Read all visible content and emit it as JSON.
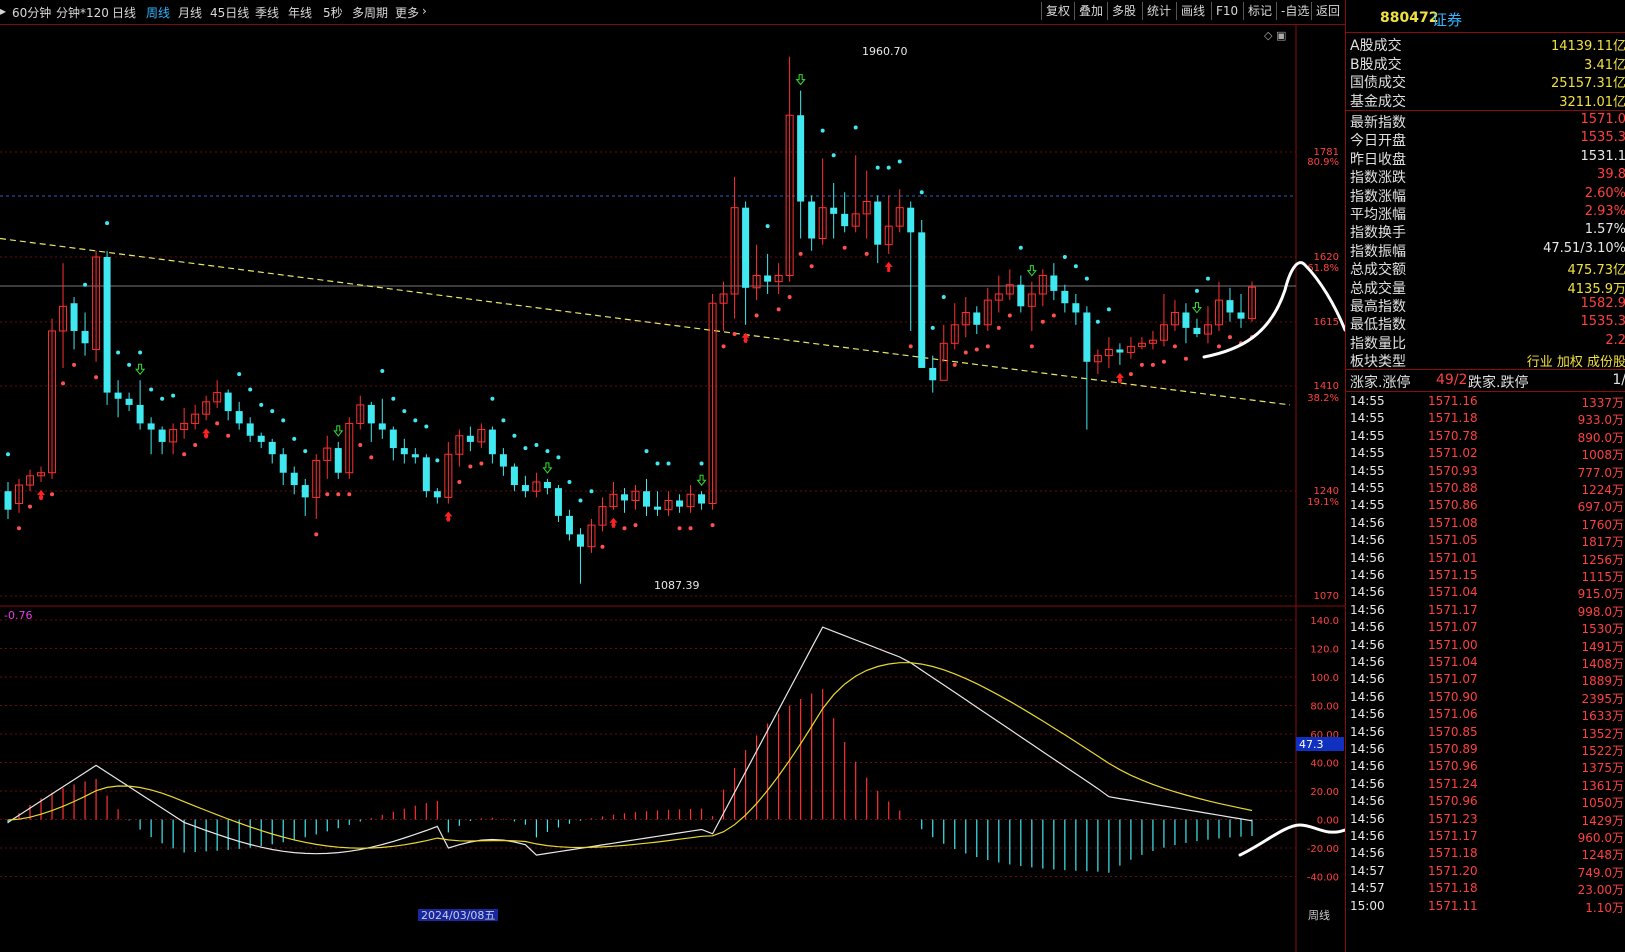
{
  "toolbar": {
    "periods": [
      "60分钟",
      "分钟*120",
      "日线",
      "周线",
      "月线",
      "45日线",
      "季线",
      "年线",
      "5秒",
      "多周期",
      "更多"
    ],
    "active_period": "周线",
    "actions": [
      "复权",
      "叠加",
      "多股",
      "统计",
      "画线",
      "F10",
      "标记",
      "-自选",
      "返回"
    ]
  },
  "chart": {
    "high_label": "1960.70",
    "low_label": "1087.39",
    "price_axis": [
      "1781",
      "1620",
      "1615",
      "1410",
      "1240",
      "1070"
    ],
    "pct_axis": [
      "80.9%",
      "61.8%",
      "38.2%",
      "19.1%"
    ],
    "macd_label": "-0.76",
    "macd_axis": [
      "140.0",
      "120.0",
      "100.0",
      "80.00",
      "60.00",
      "40.00",
      "20.00",
      "0.00",
      "-20.00",
      "-40.00"
    ],
    "macd_value_box": "47.3",
    "date_label": "2024/03/08五",
    "period_footer": "周线",
    "colors": {
      "up": "#ff3030",
      "down": "#40e8f0",
      "sar_down": "#40e8f0",
      "sar_up": "#ff5050",
      "trend": "#e8e860",
      "dif": "#e8e8e8",
      "dea": "#e8d830"
    }
  },
  "chart_data": {
    "type": "candlestick",
    "y_range": [
      1070,
      1960.7
    ],
    "candles": [
      [
        1240,
        1210,
        1255,
        1195
      ],
      [
        1220,
        1250,
        1260,
        1205
      ],
      [
        1250,
        1265,
        1275,
        1240
      ],
      [
        1265,
        1270,
        1280,
        1255
      ],
      [
        1270,
        1500,
        1520,
        1260
      ],
      [
        1500,
        1540,
        1610,
        1440
      ],
      [
        1545,
        1500,
        1555,
        1470
      ],
      [
        1500,
        1480,
        1530,
        1460
      ],
      [
        1470,
        1620,
        1630,
        1450
      ],
      [
        1620,
        1400,
        1630,
        1380
      ],
      [
        1400,
        1390,
        1420,
        1360
      ],
      [
        1390,
        1380,
        1400,
        1370
      ],
      [
        1380,
        1350,
        1420,
        1340
      ],
      [
        1350,
        1340,
        1360,
        1300
      ],
      [
        1340,
        1320,
        1345,
        1300
      ],
      [
        1320,
        1340,
        1350,
        1300
      ],
      [
        1340,
        1350,
        1375,
        1325
      ],
      [
        1350,
        1365,
        1380,
        1340
      ],
      [
        1365,
        1385,
        1395,
        1355
      ],
      [
        1385,
        1400,
        1420,
        1375
      ],
      [
        1400,
        1370,
        1405,
        1355
      ],
      [
        1370,
        1350,
        1385,
        1340
      ],
      [
        1350,
        1330,
        1360,
        1320
      ],
      [
        1330,
        1320,
        1335,
        1310
      ],
      [
        1320,
        1300,
        1325,
        1285
      ],
      [
        1300,
        1270,
        1310,
        1250
      ],
      [
        1270,
        1250,
        1280,
        1235
      ],
      [
        1250,
        1230,
        1260,
        1200
      ],
      [
        1230,
        1290,
        1300,
        1195
      ],
      [
        1290,
        1310,
        1330,
        1260
      ],
      [
        1310,
        1270,
        1320,
        1260
      ],
      [
        1270,
        1350,
        1360,
        1260
      ],
      [
        1350,
        1380,
        1395,
        1340
      ],
      [
        1380,
        1350,
        1385,
        1320
      ],
      [
        1350,
        1340,
        1390,
        1325
      ],
      [
        1340,
        1310,
        1345,
        1290
      ],
      [
        1310,
        1300,
        1325,
        1285
      ],
      [
        1300,
        1295,
        1310,
        1285
      ],
      [
        1295,
        1240,
        1300,
        1230
      ],
      [
        1240,
        1230,
        1245,
        1220
      ],
      [
        1230,
        1300,
        1320,
        1220
      ],
      [
        1300,
        1330,
        1340,
        1280
      ],
      [
        1330,
        1320,
        1345,
        1305
      ],
      [
        1320,
        1340,
        1350,
        1310
      ],
      [
        1340,
        1300,
        1345,
        1285
      ],
      [
        1300,
        1280,
        1310,
        1265
      ],
      [
        1280,
        1250,
        1285,
        1240
      ],
      [
        1250,
        1240,
        1265,
        1230
      ],
      [
        1240,
        1255,
        1270,
        1230
      ],
      [
        1255,
        1245,
        1260,
        1235
      ],
      [
        1245,
        1200,
        1250,
        1190
      ],
      [
        1200,
        1170,
        1210,
        1160
      ],
      [
        1170,
        1150,
        1180,
        1090
      ],
      [
        1150,
        1185,
        1195,
        1140
      ],
      [
        1185,
        1215,
        1230,
        1175
      ],
      [
        1215,
        1235,
        1255,
        1210
      ],
      [
        1235,
        1225,
        1245,
        1205
      ],
      [
        1225,
        1240,
        1250,
        1210
      ],
      [
        1240,
        1215,
        1260,
        1200
      ],
      [
        1215,
        1210,
        1240,
        1200
      ],
      [
        1210,
        1225,
        1240,
        1200
      ],
      [
        1225,
        1215,
        1235,
        1205
      ],
      [
        1215,
        1235,
        1250,
        1205
      ],
      [
        1235,
        1220,
        1240,
        1210
      ],
      [
        1220,
        1545,
        1560,
        1210
      ],
      [
        1545,
        1560,
        1580,
        1500
      ],
      [
        1560,
        1700,
        1750,
        1520
      ],
      [
        1700,
        1570,
        1710,
        1510
      ],
      [
        1570,
        1590,
        1640,
        1550
      ],
      [
        1590,
        1580,
        1625,
        1560
      ],
      [
        1580,
        1590,
        1610,
        1560
      ],
      [
        1590,
        1850,
        1945,
        1580
      ],
      [
        1850,
        1710,
        1890,
        1650
      ],
      [
        1710,
        1650,
        1720,
        1630
      ],
      [
        1650,
        1700,
        1780,
        1640
      ],
      [
        1700,
        1690,
        1740,
        1650
      ],
      [
        1690,
        1670,
        1725,
        1660
      ],
      [
        1670,
        1690,
        1785,
        1660
      ],
      [
        1690,
        1710,
        1760,
        1650
      ],
      [
        1710,
        1640,
        1720,
        1610
      ],
      [
        1640,
        1670,
        1720,
        1625
      ],
      [
        1670,
        1700,
        1730,
        1660
      ],
      [
        1700,
        1660,
        1710,
        1500
      ],
      [
        1660,
        1440,
        1680,
        1440
      ],
      [
        1440,
        1420,
        1460,
        1400
      ],
      [
        1420,
        1480,
        1510,
        1450
      ],
      [
        1480,
        1510,
        1545,
        1470
      ],
      [
        1510,
        1530,
        1555,
        1490
      ],
      [
        1530,
        1510,
        1540,
        1495
      ],
      [
        1510,
        1550,
        1570,
        1500
      ],
      [
        1550,
        1560,
        1590,
        1530
      ],
      [
        1560,
        1575,
        1600,
        1550
      ],
      [
        1575,
        1540,
        1590,
        1530
      ],
      [
        1540,
        1560,
        1580,
        1500
      ],
      [
        1560,
        1590,
        1600,
        1540
      ],
      [
        1590,
        1565,
        1610,
        1550
      ],
      [
        1565,
        1545,
        1575,
        1530
      ],
      [
        1545,
        1530,
        1560,
        1510
      ],
      [
        1530,
        1450,
        1540,
        1340
      ],
      [
        1450,
        1460,
        1470,
        1430
      ],
      [
        1460,
        1470,
        1490,
        1440
      ],
      [
        1470,
        1465,
        1480,
        1445
      ],
      [
        1465,
        1475,
        1490,
        1455
      ],
      [
        1475,
        1480,
        1490,
        1470
      ],
      [
        1480,
        1485,
        1500,
        1470
      ],
      [
        1485,
        1510,
        1560,
        1475
      ],
      [
        1510,
        1530,
        1550,
        1500
      ],
      [
        1530,
        1505,
        1545,
        1480
      ],
      [
        1505,
        1495,
        1520,
        1490
      ],
      [
        1495,
        1510,
        1540,
        1480
      ],
      [
        1510,
        1550,
        1580,
        1500
      ],
      [
        1550,
        1530,
        1570,
        1515
      ],
      [
        1530,
        1520,
        1560,
        1505
      ],
      [
        1520,
        1571,
        1580,
        1515
      ]
    ],
    "trend_line": {
      "from": [
        0,
        1650
      ],
      "to": [
        1,
        1380
      ]
    },
    "macd": {
      "dif_start": -2,
      "dif_peak": 135,
      "dif_end": 3,
      "dea_peak": 115,
      "current": 47.3,
      "label_value": -0.76
    }
  },
  "sidebar": {
    "code": "880472",
    "name": "证券",
    "market_rows": [
      {
        "label": "A股成交",
        "value": "14139.11亿"
      },
      {
        "label": "B股成交",
        "value": "3.41亿"
      },
      {
        "label": "国债成交",
        "value": "25157.31亿"
      },
      {
        "label": "基金成交",
        "value": "3211.01亿"
      }
    ],
    "index_rows": [
      {
        "label": "最新指数",
        "value": "1571.0",
        "color": "#ff4040"
      },
      {
        "label": "今日开盘",
        "value": "1535.3",
        "color": "#ff4040"
      },
      {
        "label": "昨日收盘",
        "value": "1531.1",
        "color": "#e8e8e8"
      },
      {
        "label": "指数涨跌",
        "value": "39.8",
        "color": "#ff4040"
      },
      {
        "label": "指数涨幅",
        "value": "2.60%",
        "color": "#ff4040"
      },
      {
        "label": "平均涨幅",
        "value": "2.93%",
        "color": "#ff4040"
      },
      {
        "label": "指数换手",
        "value": "1.57%",
        "color": "#e8e8e8"
      },
      {
        "label": "指数振幅",
        "value": "47.51/3.10%",
        "color": "#e8e8e8"
      },
      {
        "label": "总成交额",
        "value": "475.73亿",
        "color": "#f0e040"
      },
      {
        "label": "总成交量",
        "value": "4135.9万",
        "color": "#f0e040"
      },
      {
        "label": "最高指数",
        "value": "1582.9",
        "color": "#ff4040"
      },
      {
        "label": "最低指数",
        "value": "1535.3",
        "color": "#ff4040"
      },
      {
        "label": "指数量比",
        "value": "2.2",
        "color": "#ff4040"
      }
    ],
    "sector_label": "板块类型",
    "sector_value": "行业 加权 成份股",
    "updown_label": "涨家.涨停",
    "updown_value": "49/2",
    "down_label": "跌家.跌停",
    "down_value": "1/",
    "ticks": [
      {
        "time": "14:55",
        "price": "1571.16",
        "vol": "1337万"
      },
      {
        "time": "14:55",
        "price": "1571.18",
        "vol": "933.0万"
      },
      {
        "time": "14:55",
        "price": "1570.78",
        "vol": "890.0万"
      },
      {
        "time": "14:55",
        "price": "1571.02",
        "vol": "1008万"
      },
      {
        "time": "14:55",
        "price": "1570.93",
        "vol": "777.0万"
      },
      {
        "time": "14:55",
        "price": "1570.88",
        "vol": "1224万"
      },
      {
        "time": "14:55",
        "price": "1570.86",
        "vol": "697.0万"
      },
      {
        "time": "14:56",
        "price": "1571.08",
        "vol": "1760万"
      },
      {
        "time": "14:56",
        "price": "1571.05",
        "vol": "1817万"
      },
      {
        "time": "14:56",
        "price": "1571.01",
        "vol": "1256万"
      },
      {
        "time": "14:56",
        "price": "1571.15",
        "vol": "1115万"
      },
      {
        "time": "14:56",
        "price": "1571.04",
        "vol": "915.0万"
      },
      {
        "time": "14:56",
        "price": "1571.17",
        "vol": "998.0万"
      },
      {
        "time": "14:56",
        "price": "1571.07",
        "vol": "1530万"
      },
      {
        "time": "14:56",
        "price": "1571.00",
        "vol": "1491万"
      },
      {
        "time": "14:56",
        "price": "1571.04",
        "vol": "1408万"
      },
      {
        "time": "14:56",
        "price": "1571.07",
        "vol": "1889万"
      },
      {
        "time": "14:56",
        "price": "1570.90",
        "vol": "2395万"
      },
      {
        "time": "14:56",
        "price": "1571.06",
        "vol": "1633万"
      },
      {
        "time": "14:56",
        "price": "1570.85",
        "vol": "1352万"
      },
      {
        "time": "14:56",
        "price": "1570.89",
        "vol": "1522万"
      },
      {
        "time": "14:56",
        "price": "1570.96",
        "vol": "1375万"
      },
      {
        "time": "14:56",
        "price": "1571.24",
        "vol": "1361万"
      },
      {
        "time": "14:56",
        "price": "1570.96",
        "vol": "1050万"
      },
      {
        "time": "14:56",
        "price": "1571.23",
        "vol": "1429万"
      },
      {
        "time": "14:56",
        "price": "1571.17",
        "vol": "960.0万"
      },
      {
        "time": "14:56",
        "price": "1571.18",
        "vol": "1248万"
      },
      {
        "time": "14:57",
        "price": "1571.20",
        "vol": "749.0万"
      },
      {
        "time": "14:57",
        "price": "1571.18",
        "vol": "23.00万"
      },
      {
        "time": "15:00",
        "price": "1571.11",
        "vol": "1.10万"
      }
    ]
  }
}
